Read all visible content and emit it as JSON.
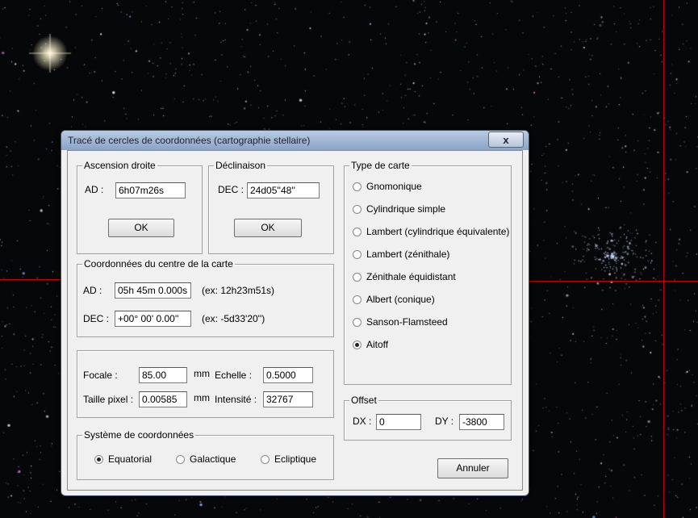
{
  "dialog": {
    "title": "Tracé de cercles de coordonnées (cartographie stellaire)",
    "close_symbol": "x"
  },
  "ascension": {
    "legend": "Ascension droite",
    "ad_label": "AD :",
    "ad_value": "6h07m26s",
    "ok_label": "OK"
  },
  "declinaison": {
    "legend": "Déclinaison",
    "dec_label": "DEC :",
    "dec_value": "24d05''48''",
    "ok_label": "OK"
  },
  "centre": {
    "legend": "Coordonnées du centre de la carte",
    "ad_label": "AD :",
    "ad_value": "05h 45m 0.000s",
    "ad_example": "(ex: 12h23m51s)",
    "dec_label": "DEC :",
    "dec_value": "+00° 00' 0.00''",
    "dec_example": "(ex: -5d33'20'')"
  },
  "params": {
    "focale_label": "Focale :",
    "focale_value": "85.00",
    "focale_unit": "mm",
    "echelle_label": "Echelle :",
    "echelle_value": "0.5000",
    "taille_label": "Taille pixel :",
    "taille_value": "0.00585",
    "taille_unit": "mm",
    "intensite_label": "Intensité :",
    "intensite_value": "32767"
  },
  "systeme": {
    "legend": "Système de coordonnées",
    "options": [
      "Equatorial",
      "Galactique",
      "Ecliptique"
    ],
    "selected": "Equatorial"
  },
  "type_carte": {
    "legend": "Type de carte",
    "options": [
      "Gnomonique",
      "Cylindrique simple",
      "Lambert (cylindrique équivalente)",
      "Lambert (zénithale)",
      "Zénithale équidistant",
      "Albert (conique)",
      "Sanson-Flamsteed",
      "Aitoff"
    ],
    "selected": "Aitoff"
  },
  "offset": {
    "legend": "Offset",
    "dx_label": "DX :",
    "dx_value": "0",
    "dy_label": "DY :",
    "dy_value": "-3800"
  },
  "cancel_label": "Annuler",
  "colors": {
    "crosshair": "#c00000",
    "sky": "#060708",
    "dialog_bg": "#f0f0f0"
  }
}
